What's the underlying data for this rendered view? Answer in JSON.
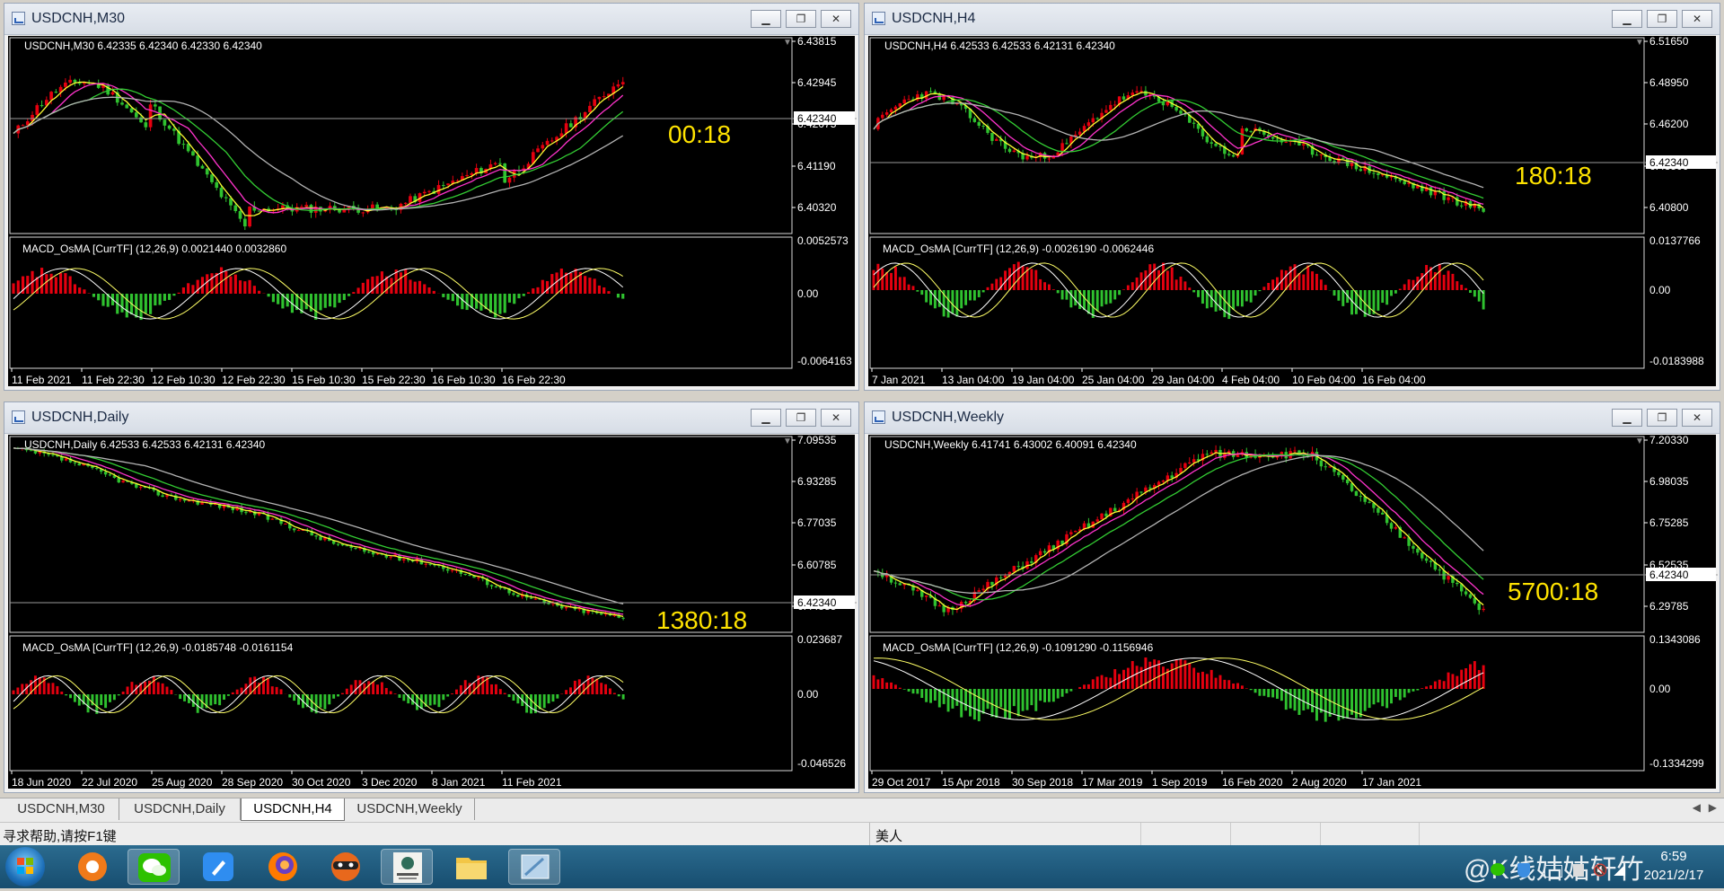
{
  "windows": {
    "m30": {
      "title": "USDCNH,M30",
      "header": "USDCNH,M30  6.42335 6.42340 6.42330 6.42340",
      "price_labels": [
        "6.43815",
        "6.42945",
        "6.42075",
        "6.41190",
        "6.40320"
      ],
      "current_price": "6.42340",
      "timer": "00:18",
      "macd_header": "MACD_OsMA [CurrTF] (12,26,9) 0.0021440 0.0032860",
      "macd_labels": [
        "0.0052573",
        "0.00",
        "-0.0064163"
      ],
      "dates": [
        "11 Feb 2021",
        "11 Feb 22:30",
        "12 Feb 10:30",
        "12 Feb 22:30",
        "15 Feb 10:30",
        "15 Feb 22:30",
        "16 Feb 10:30",
        "16 Feb 22:30"
      ]
    },
    "h4": {
      "title": "USDCNH,H4",
      "header": "USDCNH,H4  6.42533 6.42533 6.42131 6.42340",
      "price_labels": [
        "6.51650",
        "6.48950",
        "6.46200",
        "6.43500",
        "6.40800"
      ],
      "current_price": "6.42340",
      "timer": "180:18",
      "macd_header": "MACD_OsMA [CurrTF] (12,26,9) -0.0026190 -0.0062446",
      "macd_labels": [
        "0.0137766",
        "0.00",
        "-0.0183988"
      ],
      "dates": [
        "7 Jan 2021",
        "13 Jan 04:00",
        "19 Jan 04:00",
        "25 Jan 04:00",
        "29 Jan 04:00",
        "4 Feb 04:00",
        "10 Feb 04:00",
        "16 Feb 04:00"
      ]
    },
    "daily": {
      "title": "USDCNH,Daily",
      "header": "USDCNH,Daily  6.42533 6.42533 6.42131 6.42340",
      "price_labels": [
        "7.09535",
        "6.93285",
        "6.77035",
        "6.60785",
        "6.44535"
      ],
      "current_price": "6.42340",
      "timer": "1380:18",
      "macd_header": "MACD_OsMA [CurrTF] (12,26,9) -0.0185748 -0.0161154",
      "macd_labels": [
        "0.023687",
        "0.00",
        "-0.046526"
      ],
      "dates": [
        "18 Jun 2020",
        "22 Jul 2020",
        "25 Aug 2020",
        "28 Sep 2020",
        "30 Oct 2020",
        "3 Dec 2020",
        "8 Jan 2021",
        "11 Feb 2021"
      ]
    },
    "weekly": {
      "title": "USDCNH,Weekly",
      "header": "USDCNH,Weekly  6.41741 6.43002 6.40091 6.42340",
      "price_labels": [
        "7.20330",
        "6.98035",
        "6.75285",
        "6.52535",
        "6.29785"
      ],
      "current_price": "6.42340",
      "timer": "5700:18",
      "macd_header": "MACD_OsMA [CurrTF] (12,26,9) -0.1091290 -0.1156946",
      "macd_labels": [
        "0.1343086",
        "0.00",
        "-0.1334299"
      ],
      "dates": [
        "29 Oct 2017",
        "15 Apr 2018",
        "30 Sep 2018",
        "17 Mar 2019",
        "1 Sep 2019",
        "16 Feb 2020",
        "2 Aug 2020",
        "17 Jan 2021"
      ]
    }
  },
  "tabs": [
    "USDCNH,M30",
    "USDCNH,Daily",
    "USDCNH,H4",
    "USDCNH,Weekly"
  ],
  "active_tab": "USDCNH,H4",
  "status": {
    "help": "寻求帮助,请按F1键",
    "profile": "美人"
  },
  "taskbar": {
    "time": "6:59",
    "date": "2021/2/17",
    "watermark": "@K线姑姑轩竹"
  },
  "colors": {
    "bull": "#e6000f",
    "bear": "#2fc22f",
    "timer": "#ffe300",
    "ma_fast": "#ffff33",
    "ma_mid": "#ff33cc",
    "ma_slow": "#33cc33",
    "ma_long": "#b4b4b4"
  }
}
